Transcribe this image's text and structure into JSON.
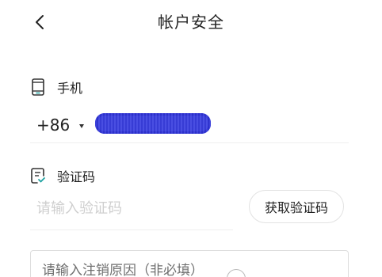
{
  "header": {
    "title": "帐户安全",
    "back_icon": "chevron-left-icon"
  },
  "phone_section": {
    "label": "手机",
    "icon": "mobile-phone-icon",
    "country_code": "+86",
    "number_masked": true,
    "mask_color": "#3a3fe0"
  },
  "code_section": {
    "label": "验证码",
    "icon": "verification-doc-icon",
    "input_placeholder": "请输入验证码",
    "get_code_button": "获取验证码"
  },
  "reason_section": {
    "placeholder": "请输入注销原因（非必填）"
  },
  "colors": {
    "accent": "#1fa2a2",
    "text": "#222222",
    "placeholder": "#cfcfcf",
    "divider": "#eeeeee"
  }
}
